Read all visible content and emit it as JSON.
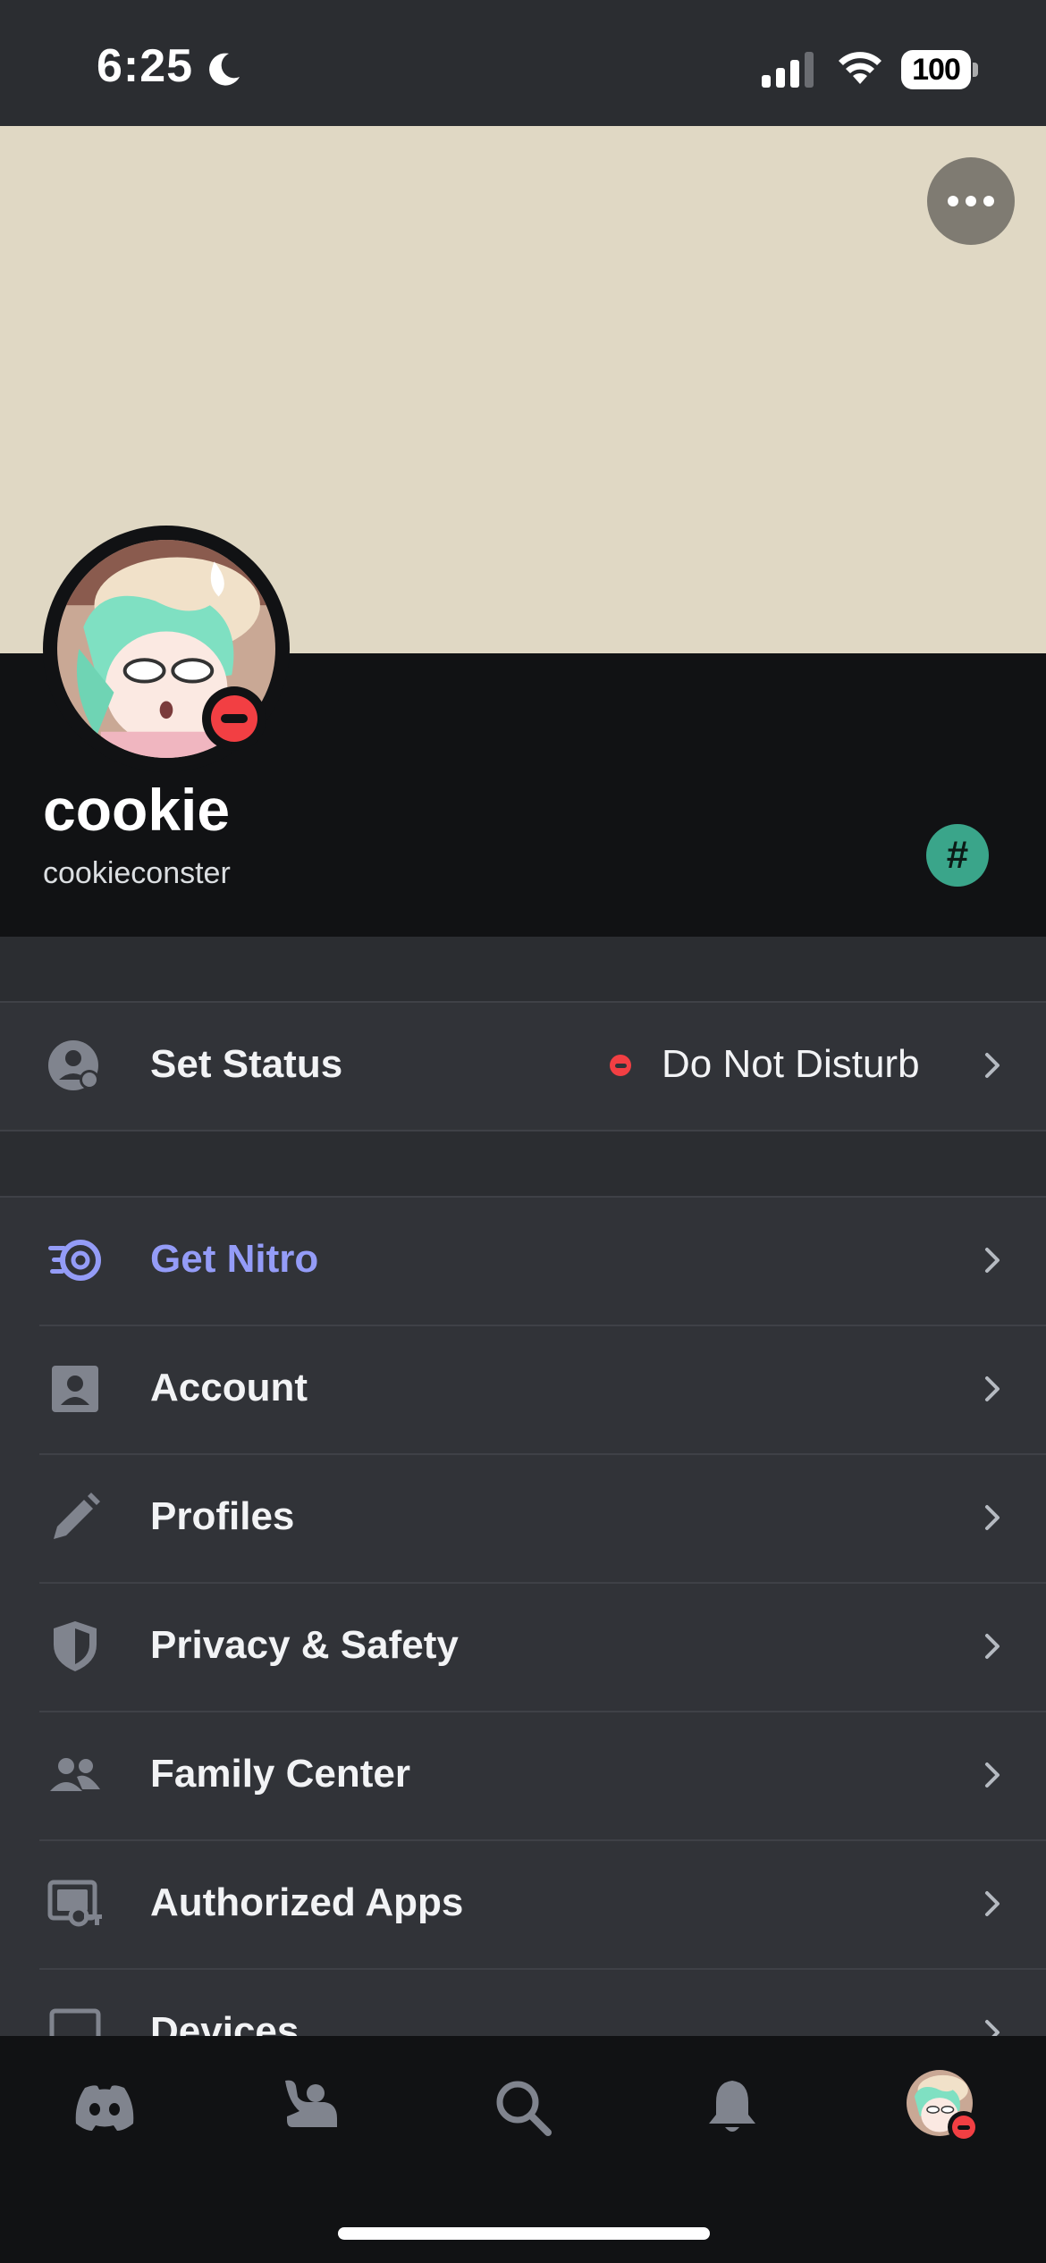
{
  "status_bar": {
    "time": "6:25",
    "battery": "100"
  },
  "profile": {
    "display_name": "cookie",
    "username": "cookieconster",
    "badge": "#"
  },
  "status_row": {
    "label": "Set Status",
    "value": "Do Not Disturb"
  },
  "settings": [
    {
      "label": "Get Nitro",
      "icon": "nitro-icon"
    },
    {
      "label": "Account",
      "icon": "account-icon"
    },
    {
      "label": "Profiles",
      "icon": "pencil-icon"
    },
    {
      "label": "Privacy & Safety",
      "icon": "shield-icon"
    },
    {
      "label": "Family Center",
      "icon": "people-icon"
    },
    {
      "label": "Authorized Apps",
      "icon": "authorized-apps-icon"
    },
    {
      "label": "Devices",
      "icon": "devices-icon"
    }
  ],
  "tabs": [
    "discord-home-icon",
    "friends-icon",
    "search-icon",
    "notifications-bell-icon",
    "profile-avatar"
  ],
  "colors": {
    "accent_nitro": "#949cf7",
    "dnd_red": "#f23f43",
    "banner": "#e0d8c4",
    "badge_green": "#3aa58a"
  }
}
